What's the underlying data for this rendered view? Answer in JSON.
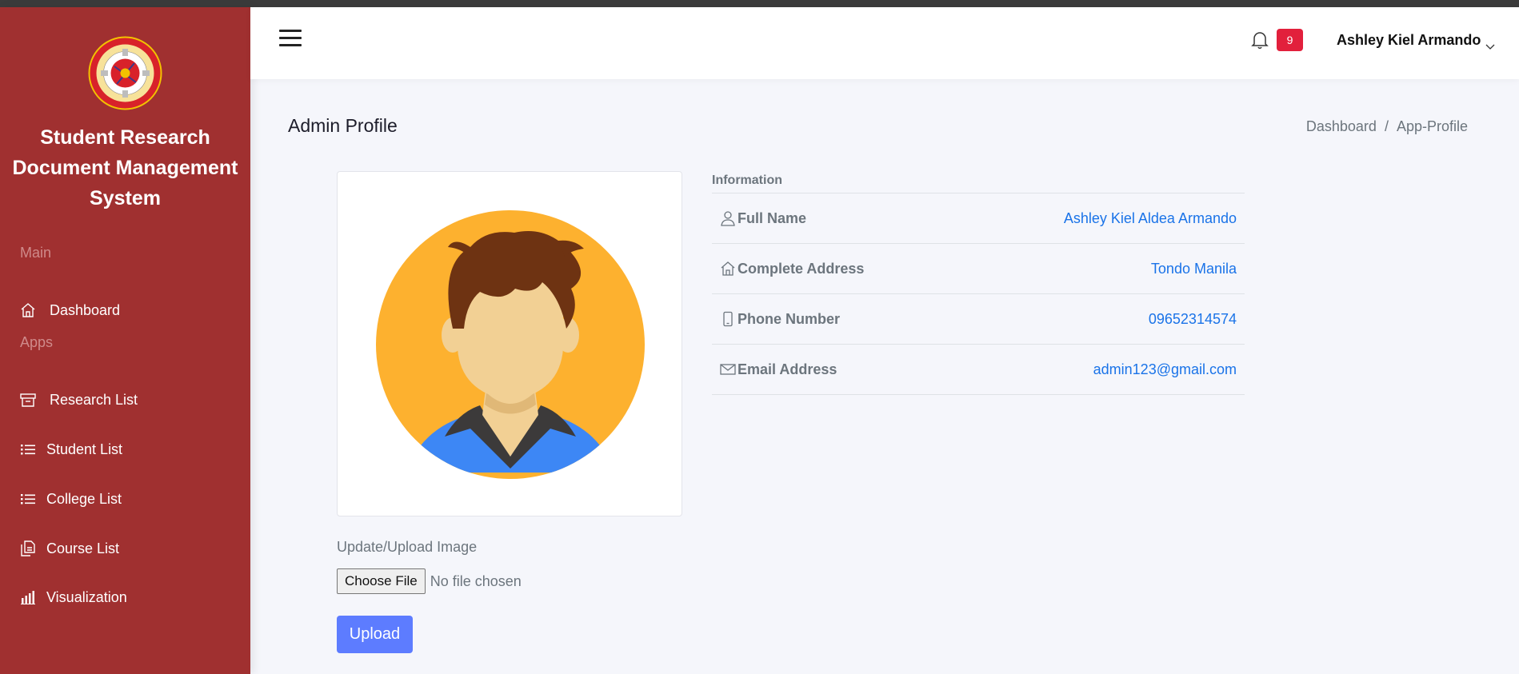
{
  "sidebar": {
    "brand": [
      "Student Research",
      "Document Management",
      "System"
    ],
    "sections": {
      "main": "Main",
      "apps": "Apps"
    },
    "items": [
      {
        "label": "Dashboard",
        "icon": "home-icon"
      },
      {
        "label": "Research List",
        "icon": "archive-icon"
      },
      {
        "label": "Student List",
        "icon": "list-icon"
      },
      {
        "label": "College List",
        "icon": "list-icon"
      },
      {
        "label": "Course List",
        "icon": "copy-icon"
      },
      {
        "label": "Visualization",
        "icon": "bar-chart-icon"
      }
    ]
  },
  "navbar": {
    "notification_count": "9",
    "user_name": "Ashley Kiel Armando"
  },
  "page": {
    "title": "Admin Profile",
    "breadcrumb": [
      "Dashboard",
      "/",
      "App-Profile"
    ]
  },
  "profile": {
    "upload_label": "Update/Upload Image",
    "choose_file": "Choose File",
    "no_file": "No file chosen",
    "upload_button": "Upload"
  },
  "info": {
    "heading": "Information",
    "rows": [
      {
        "label": "Full Name",
        "value": "Ashley Kiel Aldea Armando",
        "icon": "user-icon"
      },
      {
        "label": "Complete Address",
        "value": "Tondo Manila",
        "icon": "home-icon"
      },
      {
        "label": "Phone Number",
        "value": "09652314574",
        "icon": "phone-icon"
      },
      {
        "label": "Email Address",
        "value": "admin123@gmail.com",
        "icon": "envelope-icon"
      }
    ]
  },
  "colors": {
    "sidebar": "#a03030",
    "accent_button": "#5d7cff",
    "badge": "#e2203c",
    "link": "#1a73e8"
  }
}
